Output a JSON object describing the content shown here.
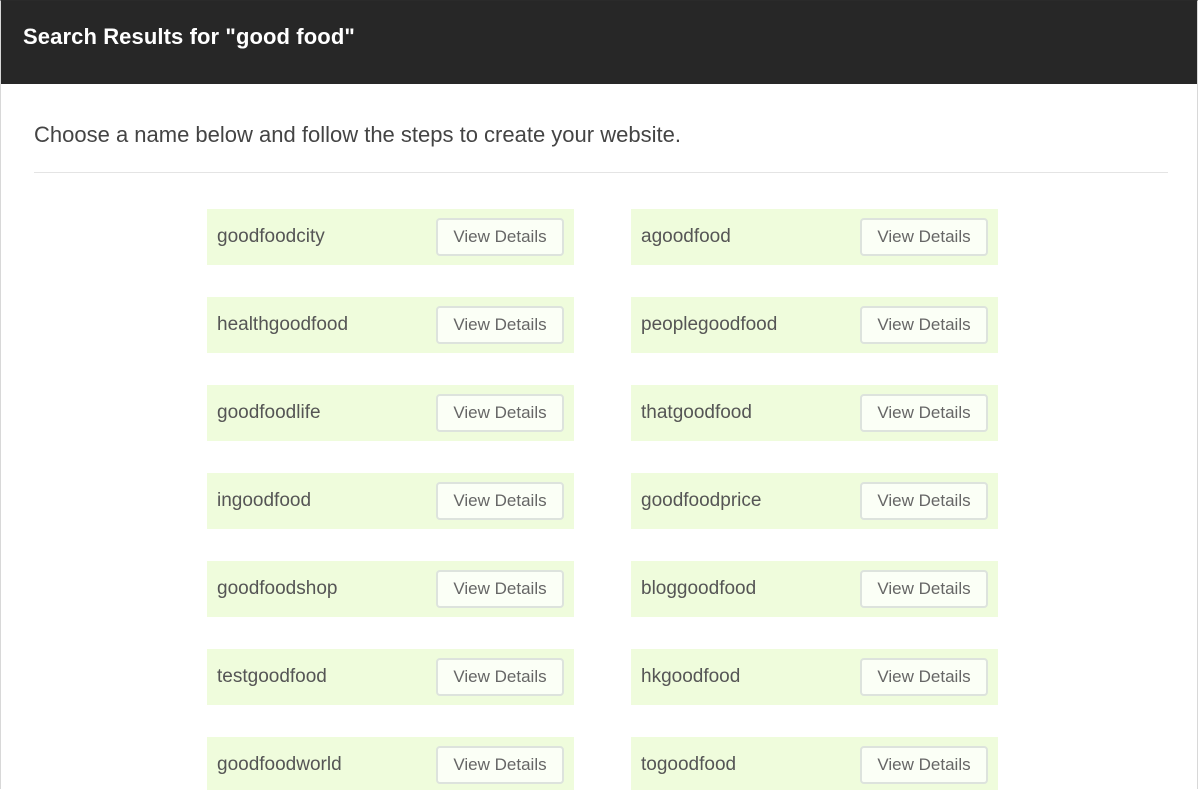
{
  "header": {
    "title": "Search Results for \"good food\""
  },
  "intro": {
    "text": "Choose a name below and follow the steps to create your website."
  },
  "results": [
    {
      "name": "goodfoodcity",
      "button": "View Details"
    },
    {
      "name": "agoodfood",
      "button": "View Details"
    },
    {
      "name": "healthgoodfood",
      "button": "View Details"
    },
    {
      "name": "peoplegoodfood",
      "button": "View Details"
    },
    {
      "name": "goodfoodlife",
      "button": "View Details"
    },
    {
      "name": "thatgoodfood",
      "button": "View Details"
    },
    {
      "name": "ingoodfood",
      "button": "View Details"
    },
    {
      "name": "goodfoodprice",
      "button": "View Details"
    },
    {
      "name": "goodfoodshop",
      "button": "View Details"
    },
    {
      "name": "bloggoodfood",
      "button": "View Details"
    },
    {
      "name": "testgoodfood",
      "button": "View Details"
    },
    {
      "name": "hkgoodfood",
      "button": "View Details"
    },
    {
      "name": "goodfoodworld",
      "button": "View Details"
    },
    {
      "name": "togoodfood",
      "button": "View Details"
    }
  ],
  "colors": {
    "header_bg": "#272727",
    "card_bg": "#effcdc"
  }
}
